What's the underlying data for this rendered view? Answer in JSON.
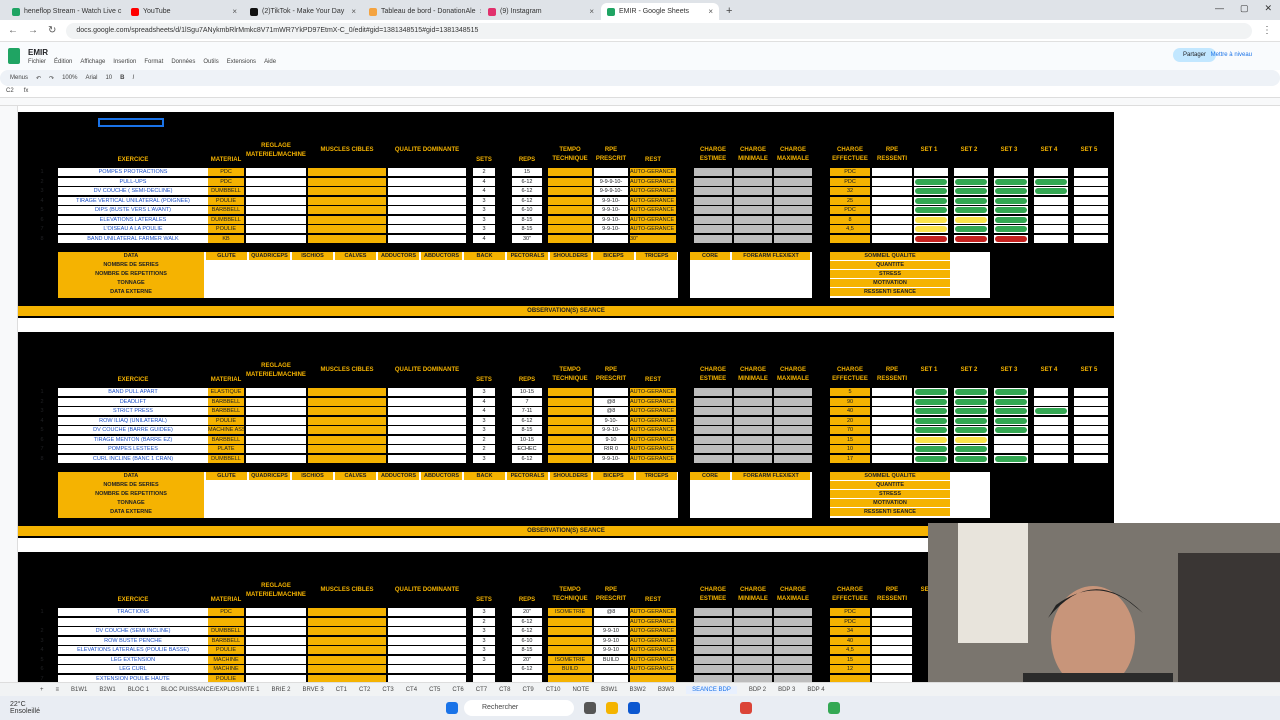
{
  "browser": {
    "tabs": [
      {
        "label": "heneflop Stream - Watch Live c",
        "icon_color": "#1fa463"
      },
      {
        "label": "YouTube",
        "icon_color": "#ff0000"
      },
      {
        "label": "(2)TikTok - Make Your Day",
        "icon_color": "#111111"
      },
      {
        "label": "Tableau de bord - DonationAle",
        "icon_color": "#f4a340"
      },
      {
        "label": "(9) Instagram",
        "icon_color": "#e1306c"
      },
      {
        "label": "EMIR - Google Sheets",
        "icon_color": "#1fa463",
        "active": true
      }
    ],
    "url": "docs.google.com/spreadsheets/d/1lSgu7ANykmbRlrMmkc8V71mWR7YkPD97EtmX-C_0/edit#gid=1381348515#gid=1381348515"
  },
  "doc": {
    "title": "EMIR",
    "menus": [
      "Fichier",
      "Édition",
      "Affichage",
      "Insertion",
      "Format",
      "Données",
      "Outils",
      "Extensions",
      "Aide"
    ],
    "share_label": "Partager",
    "upgrade_label": "Mettre à niveau"
  },
  "toolbar": {
    "menus_label": "Menus",
    "zoom": "100%",
    "font": "Arial",
    "font_size": "10"
  },
  "formula": {
    "cell_ref": "C2",
    "fx": "fx"
  },
  "headers": {
    "exercice": "EXERCICE",
    "materiel": "MATERIAL",
    "reglage": "REGLAGE MATERIEL/MACHINE",
    "muscles": "MUSCLES CIBLES",
    "qualite": "QUALITE DOMINANTE",
    "sets": "SETS",
    "reps": "REPS",
    "tempo": "TEMPO TECHNIQUE",
    "rpe_prescrit": "RPE PRESCRIT",
    "rest": "REST",
    "charge_estimee": "CHARGE ESTIMEE",
    "charge_min": "CHARGE MINIMALE",
    "charge_max": "CHARGE MAXIMALE",
    "charge_eff": "CHARGE EFFECTUEE",
    "rpe_ressenti": "RPE RESSENTI",
    "set1": "SET 1",
    "set2": "SET 2",
    "set3": "SET 3",
    "set4": "SET 4",
    "set5": "SET 5"
  },
  "data_table": {
    "title": "DATA",
    "rows": [
      "NOMBRE DE SERIES",
      "NOMBRE DE REPETITIONS",
      "TONNAGE",
      "DATA EXTERNE"
    ],
    "muscles": [
      "GLUTE",
      "QUADRICEPS",
      "ISCHIOS",
      "CALVES",
      "ADDUCTORS",
      "ABDUCTORS",
      "BACK",
      "PECTORALS",
      "SHOULDERS",
      "BICEPS",
      "TRICEPS"
    ],
    "extra": [
      "CORE",
      "FOREARM FLEX/EXT"
    ],
    "wellness": [
      "SOMMEIL QUALITE",
      "QUANTITE",
      "STRESS",
      "MOTIVATION",
      "RESSENTI SEANCE"
    ]
  },
  "observation_label": "OBSERVATION(S) SEANCE",
  "session1": [
    {
      "n": "1",
      "ex": "POMPES PROTRACTIONS",
      "mat": "PDC",
      "sets": "2",
      "reps": "15",
      "rpe": "",
      "rest": "AUTO-GERANCE",
      "eff": "PDC",
      "s": [
        "",
        "",
        "",
        "",
        ""
      ]
    },
    {
      "n": "2",
      "ex": "PULL-UPS",
      "mat": "PDC",
      "sets": "4",
      "reps": "6-12",
      "rpe": "9-9-9-10-",
      "rest": "AUTO-GERANCE",
      "eff": "PDC",
      "s": [
        "g",
        "g",
        "g",
        "g",
        ""
      ]
    },
    {
      "n": "3",
      "ex": "DV COUCHE ( SEMI-DECLINE)",
      "mat": "DUMBBELL",
      "sets": "4",
      "reps": "6-12",
      "rpe": "9-9-9-10-",
      "rest": "AUTO-GERANCE",
      "eff": "32",
      "s": [
        "g",
        "g",
        "g",
        "g",
        ""
      ]
    },
    {
      "n": "4",
      "ex": "TIRAGE VERTICAL UNILATERAL (POIGNEE)",
      "mat": "POULIE",
      "sets": "3",
      "reps": "6-12",
      "rpe": "9-9-10-",
      "rest": "AUTO-GERANCE",
      "eff": "25",
      "s": [
        "g",
        "g",
        "g",
        "",
        ""
      ]
    },
    {
      "n": "5",
      "ex": "DIPS (BUSTE VERS L'AVANT)",
      "mat": "BARBBELL",
      "sets": "3",
      "reps": "6-10",
      "rpe": "9-9-10-",
      "rest": "AUTO-GERANCE",
      "eff": "PDC",
      "s": [
        "g",
        "g",
        "g",
        "",
        ""
      ]
    },
    {
      "n": "6",
      "ex": "ELEVATIONS LATERALES",
      "mat": "DUMBBELL",
      "sets": "3",
      "reps": "8-15",
      "rpe": "9-9-10-",
      "rest": "AUTO-GERANCE",
      "eff": "8",
      "s": [
        "y",
        "y",
        "g",
        "",
        ""
      ]
    },
    {
      "n": "7",
      "ex": "L'OISEAU A LA POULIE",
      "mat": "POULIE",
      "sets": "3",
      "reps": "8-15",
      "rpe": "9-9-10-",
      "rest": "AUTO-GERANCE",
      "eff": "4,5",
      "s": [
        "y",
        "g",
        "g",
        "",
        ""
      ]
    },
    {
      "n": "8",
      "ex": "BAND UNILATERAL FARMER WALK",
      "mat": "KB",
      "sets": "4",
      "reps": "30\"",
      "rpe": "",
      "rest": "30\"",
      "eff": "",
      "s": [
        "r",
        "r",
        "r",
        "",
        ""
      ]
    }
  ],
  "session2": [
    {
      "n": "1",
      "ex": "BAND PULL APART",
      "mat": "ELASTIQUE",
      "sets": "3",
      "reps": "10-15",
      "rpe": "",
      "rest": "AUTO-GERANCE",
      "eff": "5",
      "s": [
        "g",
        "g",
        "g",
        "",
        ""
      ]
    },
    {
      "n": "2",
      "ex": "DEADLIFT",
      "mat": "BARBBELL",
      "sets": "4",
      "reps": "7",
      "rpe": "@8",
      "rest": "AUTO-GERANCE",
      "eff": "90",
      "s": [
        "g",
        "g",
        "g",
        "",
        ""
      ]
    },
    {
      "n": "3",
      "ex": "STRICT PRESS",
      "mat": "BARBBELL",
      "sets": "4",
      "reps": "7-11",
      "rpe": "@8",
      "rest": "AUTO-GERANCE",
      "eff": "40",
      "s": [
        "g",
        "g",
        "g",
        "g",
        ""
      ]
    },
    {
      "n": "4",
      "ex": "ROW ILIAQ (UNILATERAL)",
      "mat": "POULIE",
      "sets": "3",
      "reps": "6-12",
      "rpe": "9-10-",
      "rest": "AUTO-GERANCE",
      "eff": "20",
      "s": [
        "g",
        "g",
        "g",
        "",
        ""
      ]
    },
    {
      "n": "5",
      "ex": "DV COUCHE (BARRE GUIDEE)",
      "mat": "MACHINE ASSIST",
      "sets": "3",
      "reps": "8-15",
      "rpe": "9-9-10-",
      "rest": "AUTO-GERANCE",
      "eff": "70",
      "s": [
        "g",
        "g",
        "g",
        "",
        ""
      ]
    },
    {
      "n": "6",
      "ex": "TIRAGE MENTON (BARRE EZ)",
      "mat": "BARBBELL",
      "sets": "2",
      "reps": "10-15",
      "rpe": "9-10",
      "rest": "AUTO-GERANCE",
      "eff": "15",
      "s": [
        "y",
        "y",
        "",
        "",
        ""
      ]
    },
    {
      "n": "7",
      "ex": "POMPES LESTEES",
      "mat": "PLATE",
      "sets": "2",
      "reps": "ECHEC",
      "rpe": "RIR 0",
      "rest": "AUTO-GERANCE",
      "eff": "10",
      "s": [
        "g",
        "g",
        "",
        "",
        ""
      ]
    },
    {
      "n": "8",
      "ex": "CURL INCLINE (BANC 1 CRAN)",
      "mat": "DUMBBELL",
      "sets": "3",
      "reps": "6-12",
      "rpe": "9-9-10-",
      "rest": "AUTO-GERANCE",
      "eff": "17",
      "s": [
        "g",
        "g",
        "g",
        "",
        ""
      ]
    }
  ],
  "session3": [
    {
      "n": "1",
      "ex": "TRACTIONS",
      "mat": "PDC",
      "sets": "3",
      "reps": "20\"",
      "tempo": "ISOMETRIE",
      "rpe": "@8",
      "rest": "AUTO-GERANCE",
      "eff": "PDC"
    },
    {
      "n": "",
      "ex": "",
      "mat": "",
      "sets": "2",
      "reps": "6-12",
      "tempo": "",
      "rpe": "",
      "rest": "AUTO-GERANCE",
      "eff": "PDC"
    },
    {
      "n": "2",
      "ex": "DV COUCHE (SEMI INCLINE)",
      "mat": "DUMBBELL",
      "sets": "3",
      "reps": "6-12",
      "tempo": "",
      "rpe": "9-9-10",
      "rest": "AUTO-GERANCE",
      "eff": "34"
    },
    {
      "n": "3",
      "ex": "ROW BUSTE PENCHE",
      "mat": "BARBBELL",
      "sets": "3",
      "reps": "6-10",
      "tempo": "",
      "rpe": "9-9-10",
      "rest": "AUTO-GERANCE",
      "eff": "40"
    },
    {
      "n": "4",
      "ex": "ELEVATIONS LATERALES (POULIE BASSE)",
      "mat": "POULIE",
      "sets": "3",
      "reps": "8-15",
      "tempo": "",
      "rpe": "9-9-10",
      "rest": "AUTO-GERANCE",
      "eff": "4,5"
    },
    {
      "n": "5",
      "ex": "LEG EXTENSION",
      "mat": "MACHINE",
      "sets": "3",
      "reps": "20\"",
      "tempo": "ISOMETRIE",
      "rpe": "BUILD",
      "rest": "AUTO-GERANCE",
      "eff": "15"
    },
    {
      "n": "6",
      "ex": "LEG CURL",
      "mat": "MACHINE",
      "sets": "",
      "reps": "6-12",
      "tempo": "BUILD",
      "rpe": "",
      "rest": "AUTO-GERANCE",
      "eff": "12"
    },
    {
      "n": "7",
      "ex": "EXTENSION POULIE HAUTE",
      "mat": "POULIE",
      "sets": "",
      "reps": "",
      "tempo": "",
      "rpe": "",
      "rest": "",
      "eff": ""
    }
  ],
  "sheet_tabs": [
    "B1W1",
    "B2W1",
    "BLOC 1",
    "BLOC PUISSANCE/EXPLOSIVITE 1",
    "BRIE 2",
    "BRVE 3",
    "CT1",
    "CT2",
    "CT3",
    "CT4",
    "CT5",
    "CT6",
    "CT7",
    "CT8",
    "CT9",
    "CT10",
    "NOTE",
    "B3W1",
    "B3W2",
    "B3W3",
    "SEANCE BDP",
    "BDP 2",
    "BDP 3",
    "BDP 4"
  ],
  "active_sheet": "SEANCE BDP",
  "taskbar": {
    "weather_temp": "22°C",
    "weather_text": "Ensoleillé",
    "search_label": "Rechercher"
  }
}
